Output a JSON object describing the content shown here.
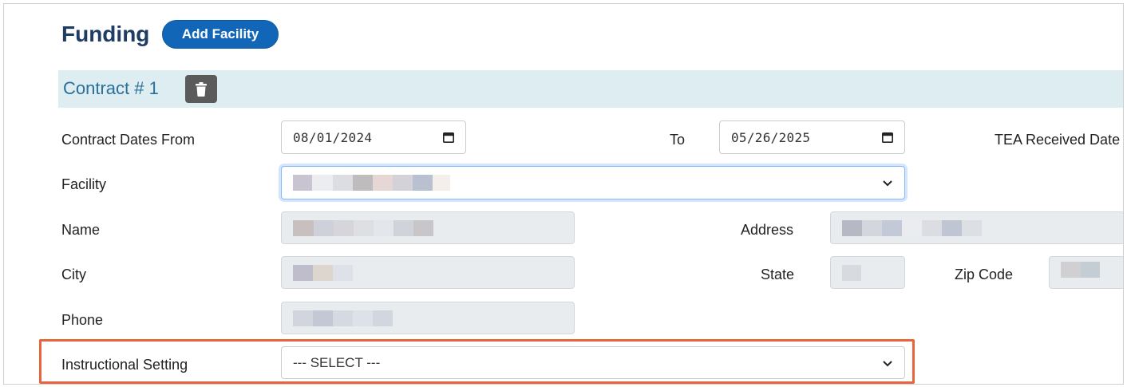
{
  "header": {
    "title": "Funding",
    "add_button_label": "Add Facility"
  },
  "contract": {
    "title": "Contract # 1"
  },
  "form": {
    "contract_dates_from_label": "Contract Dates From",
    "contract_dates_from_value": "08/01/2024",
    "to_label": "To",
    "to_value": "05/26/2025",
    "tea_received_date_label": "TEA Received Date",
    "facility_label": "Facility",
    "name_label": "Name",
    "address_label": "Address",
    "city_label": "City",
    "state_label": "State",
    "zip_code_label": "Zip Code",
    "phone_label": "Phone",
    "instructional_setting_label": "Instructional Setting",
    "instructional_setting_value": "--- SELECT ---"
  },
  "colors": {
    "title": "#1f3d63",
    "button": "#1166b8",
    "contract_bar": "#ddedf2",
    "highlight": "#e8643c"
  },
  "icons": [
    "trash-icon",
    "calendar-icon",
    "chevron-down-icon"
  ]
}
